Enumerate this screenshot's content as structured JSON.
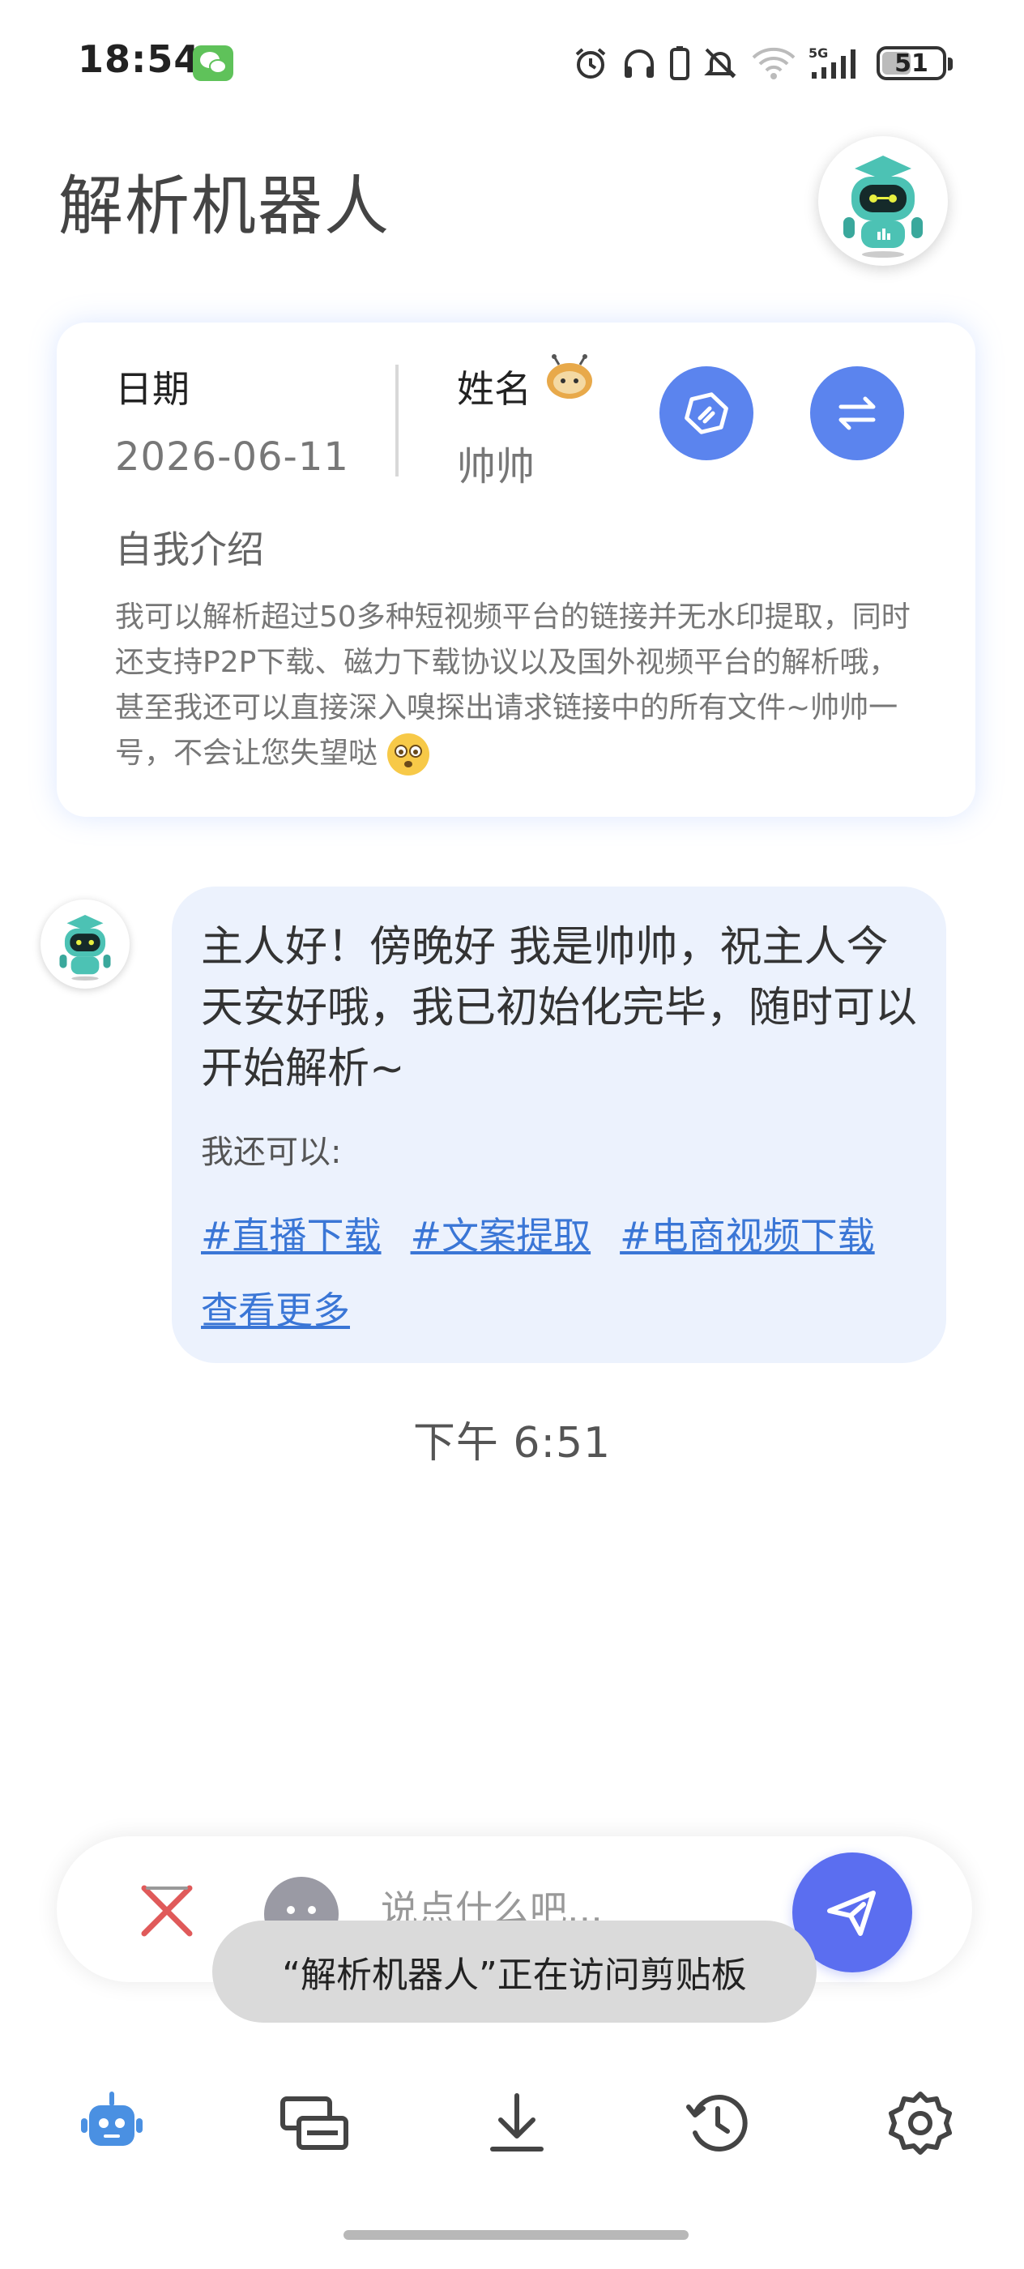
{
  "status_bar": {
    "time": "18:54",
    "battery": "51",
    "icons": [
      "wechat-icon",
      "alarm-icon",
      "headphones-icon",
      "mute-icon",
      "wifi-icon",
      "signal-5g-icon",
      "battery-icon"
    ]
  },
  "header": {
    "title": "解析机器人"
  },
  "info_card": {
    "date_label": "日期",
    "date_value": "2026-06-11",
    "name_label": "姓名",
    "name_value": "帅帅",
    "intro_label": "自我介绍",
    "intro_text": "我可以解析超过50多种短视频平台的链接并无水印提取，同时还支持P2P下载、磁力下载协议以及国外视频平台的解析哦，甚至我还可以直接深入嗅探出请求链接中的所有文件~帅帅一号，不会让您失望哒"
  },
  "message": {
    "text": "主人好！傍晚好 我是帅帅，祝主人今天安好哦，我已初始化完毕，随时可以开始解析~",
    "sub_label": "我还可以:",
    "links": [
      "#直播下载",
      "#文案提取",
      "#电商视频下载"
    ],
    "more_link": "查看更多",
    "timestamp": "下午 6:51"
  },
  "input_bar": {
    "placeholder": "说点什么吧..."
  },
  "toast": {
    "text": "“解析机器人”正在访问剪贴板"
  },
  "colors": {
    "accent_blue": "#5b84ee",
    "send_blue": "#5b6ef0",
    "link_blue": "#3a76d6",
    "bubble_bg": "#ecf2fd",
    "clear_red": "#e05a5a",
    "robot_teal": "#4cc2b4"
  }
}
